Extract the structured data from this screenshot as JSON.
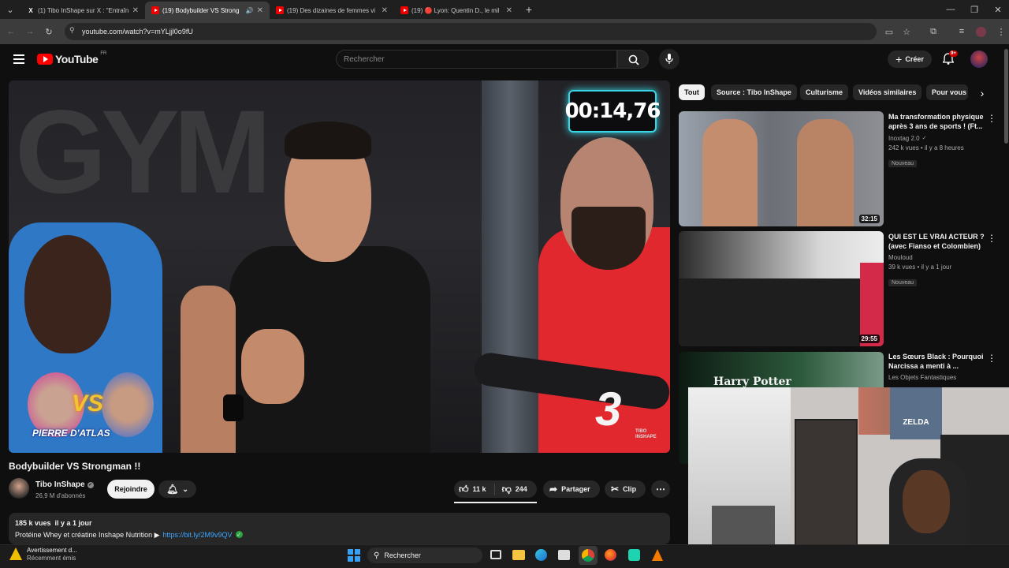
{
  "browser": {
    "tabs": [
      {
        "title": "(1) Tibo InShape sur X : \"Entraîn",
        "icon": "x-logo-icon"
      },
      {
        "title": "(19) Bodybuilder VS Strong",
        "icon": "youtube-icon",
        "active": true
      },
      {
        "title": "(19) Des dizaines de femmes vi",
        "icon": "youtube-icon"
      },
      {
        "title": "(19) 🔴 Lyon: Quentin D., le mil",
        "icon": "youtube-icon"
      }
    ],
    "url": "youtube.com/watch?v=mYLjjl0o9fU"
  },
  "youtube": {
    "logo_text": "YouTube",
    "logo_region": "FR",
    "search_placeholder": "Rechercher",
    "create_label": "Créer",
    "notif_count": "9+"
  },
  "video": {
    "timer": "00:14,76",
    "overlay_number": "3",
    "overlay_vs": "VS",
    "overlay_name": "PIERRE D'ATLAS",
    "overlay_gym": "GYM",
    "watermark": "TIBO INSHAPE",
    "title": "Bodybuilder VS Strongman !!",
    "channel": "Tibo InShape",
    "subscribers": "26,9 M d'abonnés",
    "join_label": "Rejoindre",
    "likes": "11 k",
    "dislikes": "244",
    "share_label": "Partager",
    "clip_label": "Clip",
    "views_date": "185 k vues  il y a 1 jour",
    "description": "Protéine Whey et créatine Inshape Nutrition ▶",
    "description_link": "https://bit.ly/2M9v9QV"
  },
  "chips": [
    "Tout",
    "Source : Tibo InShape",
    "Culturisme",
    "Vidéos similaires",
    "Pour vous"
  ],
  "recommendations": [
    {
      "title": "Ma transformation physique après 3 ans de sports ! (Ft...",
      "channel": "Inoxtag 2.0",
      "meta": "242 k vues • il y a 8 heures",
      "badge": "Nouveau",
      "duration": "32:15"
    },
    {
      "title": "QUI EST LE VRAI ACTEUR ? (avec Fianso et Colombien)",
      "channel": "Mouloud",
      "meta": "39 k vues • il y a 1 jour",
      "badge": "Nouveau",
      "duration": "29:55"
    },
    {
      "title": "Les Sœurs Black : Pourquoi Narcissa a menti à ...",
      "channel": "Les Objets Fantastiques",
      "meta": "",
      "badge": "",
      "duration": "",
      "thumb_text": "Harry Potter"
    }
  ],
  "webcam": {
    "poster_text": "ZELDA"
  },
  "taskbar": {
    "notif_title": "Avertissement d...",
    "notif_sub": "Récemment émis",
    "search_label": "Rechercher"
  }
}
